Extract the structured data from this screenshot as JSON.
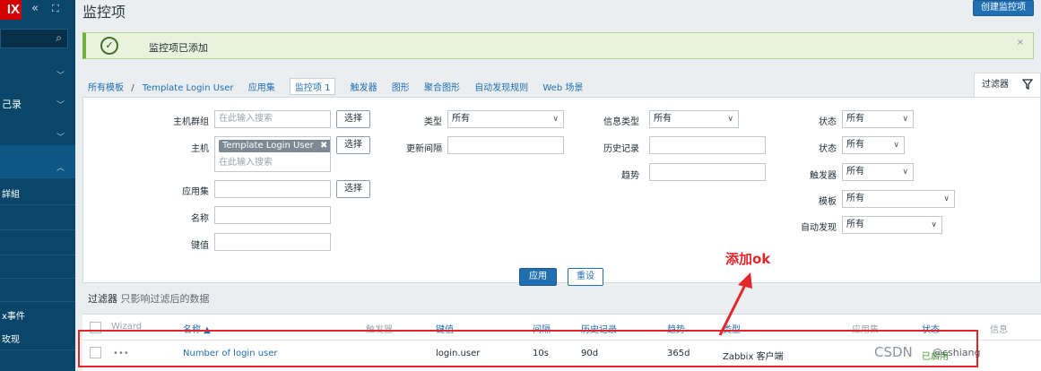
{
  "sidebar": {
    "logo": "IX",
    "collapse_icon": "double-chevron-left-icon",
    "expand_icon": "fullscreen-icon",
    "search_icon": "search-icon",
    "items": [
      {
        "label": "己录"
      },
      {
        "label": "詳組"
      },
      {
        "label": "x事件"
      },
      {
        "label": "玫现"
      }
    ]
  },
  "header": {
    "title": "监控项",
    "create_button": "创建监控项"
  },
  "message": {
    "text": "监控项已添加",
    "icon": "check-circle-icon",
    "close": "×"
  },
  "breadcrumb": {
    "all_templates": "所有模板",
    "separator": "/",
    "template": "Template Login User",
    "tabs": [
      {
        "label": "应用集"
      },
      {
        "label": "监控项 1"
      },
      {
        "label": "触发器"
      },
      {
        "label": "图形"
      },
      {
        "label": "聚合图形"
      },
      {
        "label": "自动发现规则"
      },
      {
        "label": "Web 场景"
      }
    ]
  },
  "filter_tab": {
    "label": "过滤器"
  },
  "filter": {
    "host_group_label": "主机群组",
    "host_group_placeholder": "在此输入搜索",
    "select_button": "选择",
    "host_label": "主机",
    "host_chip": "Template Login User",
    "host_chip_close": "✖",
    "host_placeholder": "在此输入搜索",
    "app_label": "应用集",
    "name_label": "名称",
    "key_label": "键值",
    "type_label": "类型",
    "type_value": "所有",
    "interval_label": "更新间隔",
    "info_type_label": "信息类型",
    "info_type_value": "所有",
    "history_label": "历史记录",
    "trends_label": "趋势",
    "state_label": "状态",
    "state_value": "所有",
    "status_label": "状态",
    "status_value": "所有",
    "triggers_label": "触发器",
    "triggers_value": "所有",
    "template_label": "模板",
    "template_value": "所有",
    "discovery_label": "自动发现",
    "discovery_value": "所有",
    "apply_button": "应用",
    "reset_button": "重设"
  },
  "filter_note": {
    "prefix": "过滤器",
    "rest": " 只影响过滤后的数据"
  },
  "table": {
    "headers": {
      "wizard": "Wizard",
      "name": "名称 ▲",
      "triggers": "触发器",
      "key": "键值",
      "interval": "间隔",
      "history": "历史记录",
      "trends": "趋势",
      "type": "类型",
      "applications": "应用集",
      "status": "状态",
      "info": "信息"
    },
    "rows": [
      {
        "wizard": "•••",
        "name": "Number of login user",
        "key": "login.user",
        "interval": "10s",
        "history": "90d",
        "trends": "365d",
        "type": "Zabbix 客户端",
        "status": "已启用"
      }
    ]
  },
  "annotation": {
    "text": "添加ok"
  },
  "watermark": {
    "text": "CSDN",
    "user": "@cshiang"
  },
  "colors": {
    "sidebar": "#0a466a",
    "accent": "#1f6fb2",
    "success_bg": "#e7f3dc",
    "annotation_red": "#e3262a"
  }
}
